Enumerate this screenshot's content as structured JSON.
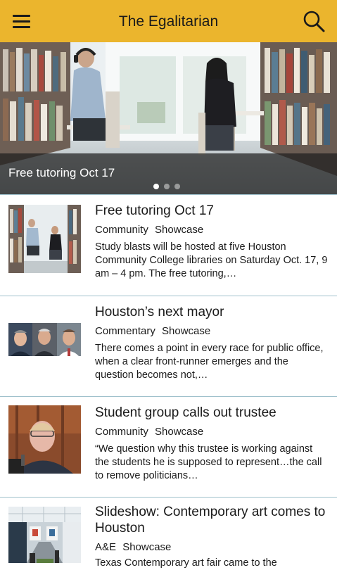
{
  "app": {
    "title": "The Egalitarian",
    "accent_color": "#ebb52d",
    "menu_icon": "hamburger-menu-icon",
    "search_icon": "search-icon"
  },
  "hero": {
    "caption": "Free tutoring Oct 17",
    "slide_count": 3,
    "active_slide": 1
  },
  "articles": [
    {
      "title": "Free tutoring Oct 17",
      "categories": [
        "Community",
        "Showcase"
      ],
      "excerpt": "Study blasts will be hosted at five Houston Community College libraries on Saturday Oct. 17, 9 am – 4 pm. The free tutoring,…"
    },
    {
      "title": "Houston’s next mayor",
      "categories": [
        "Commentary",
        "Showcase"
      ],
      "excerpt": "There comes a point in every race for public office, when a clear front-runner emerges and the question becomes not,…"
    },
    {
      "title": "Student group calls out trustee",
      "categories": [
        "Community",
        "Showcase"
      ],
      "excerpt": "“We question why this trustee is working against the students he is supposed to represent…the call to remove politicians…"
    },
    {
      "title": "Slideshow: Contemporary art comes to Houston",
      "categories": [
        "A&E",
        "Showcase"
      ],
      "excerpt": "Texas Contemporary art fair came to the"
    }
  ]
}
